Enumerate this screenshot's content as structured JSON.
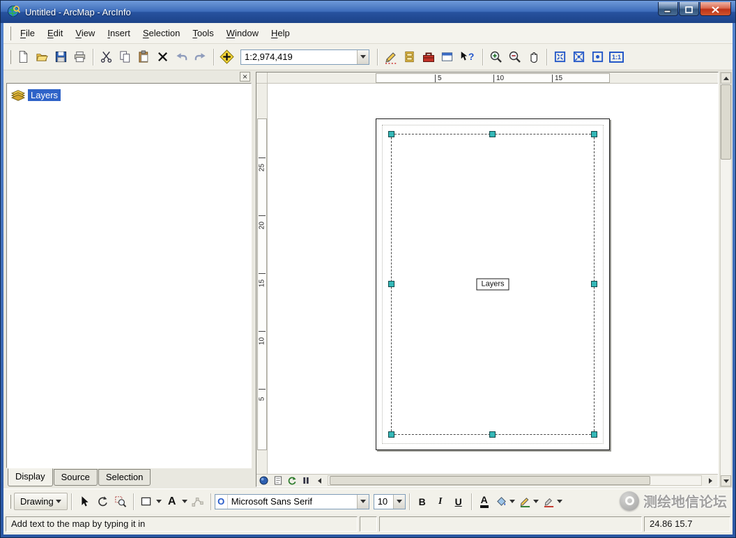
{
  "window": {
    "title": "Untitled - ArcMap - ArcInfo"
  },
  "menu": {
    "items": [
      {
        "label": "File"
      },
      {
        "label": "Edit"
      },
      {
        "label": "View"
      },
      {
        "label": "Insert"
      },
      {
        "label": "Selection"
      },
      {
        "label": "Tools"
      },
      {
        "label": "Window"
      },
      {
        "label": "Help"
      }
    ]
  },
  "toolbar": {
    "scale_value": "1:2,974,419",
    "zoom_100_label": "1:1"
  },
  "toc": {
    "close_glyph": "×",
    "root_label": "Layers",
    "tabs": [
      {
        "label": "Display"
      },
      {
        "label": "Source"
      },
      {
        "label": "Selection"
      }
    ]
  },
  "layout": {
    "h_ruler_ticks": [
      "5",
      "10",
      "15"
    ],
    "v_ruler_ticks": [
      "25",
      "20",
      "15",
      "10",
      "5"
    ],
    "page_label": "Layers"
  },
  "drawing": {
    "menu_label": "Drawing",
    "font_name": "Microsoft Sans Serif",
    "font_size": "10",
    "bold_label": "B",
    "italic_label": "I",
    "underline_label": "U",
    "font_color_label": "A"
  },
  "watermark": {
    "text": "测绘地信论坛"
  },
  "status": {
    "message": "Add text to the map by typing it in",
    "coordinates": "24.86 15.7"
  },
  "colors": {
    "titlebar_blue": "#2d5fb0",
    "selection_blue": "#2f63c8",
    "handle_teal": "#35b8b8",
    "arctoolbox_red": "#c23227"
  }
}
